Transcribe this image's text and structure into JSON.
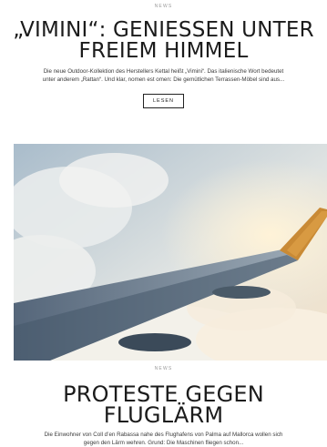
{
  "articles": [
    {
      "category": "NEWS",
      "headline_line1": "„Vimini“: Geniessen unter",
      "headline_line2": "freiem Himmel",
      "teaser_line1": "Die neue Outdoor-Kollektion des Herstellers Kettal heißt „Vimini“. Das italienische Wort bedeutet",
      "teaser_line2": "unter anderem „Rattan“. Und klar, nomen est omen: Die gemütlichen Terrassen-Möbel sind aus...",
      "button_label": "LESEN"
    },
    {
      "category": "NEWS",
      "headline": "Proteste gegen Fluglärm",
      "teaser_line1": "Die Einwohner von Coll d’en Rabassa nahe des Flughafens von Palma auf Mallorca wollen sich",
      "teaser_line2": "gegen den Lärm wehren. Grund: Die Maschinen fliegen schon..."
    }
  ],
  "hero_image": {
    "description_icon": "airplane-wing-photo",
    "colors": {
      "sky": "#c9d6df",
      "cloud": "#eef0ef",
      "wing": "#6f8190",
      "wing_dark": "#3c4c5a",
      "winglet": "#d99a3c",
      "sun": "#f6e7c9"
    }
  }
}
